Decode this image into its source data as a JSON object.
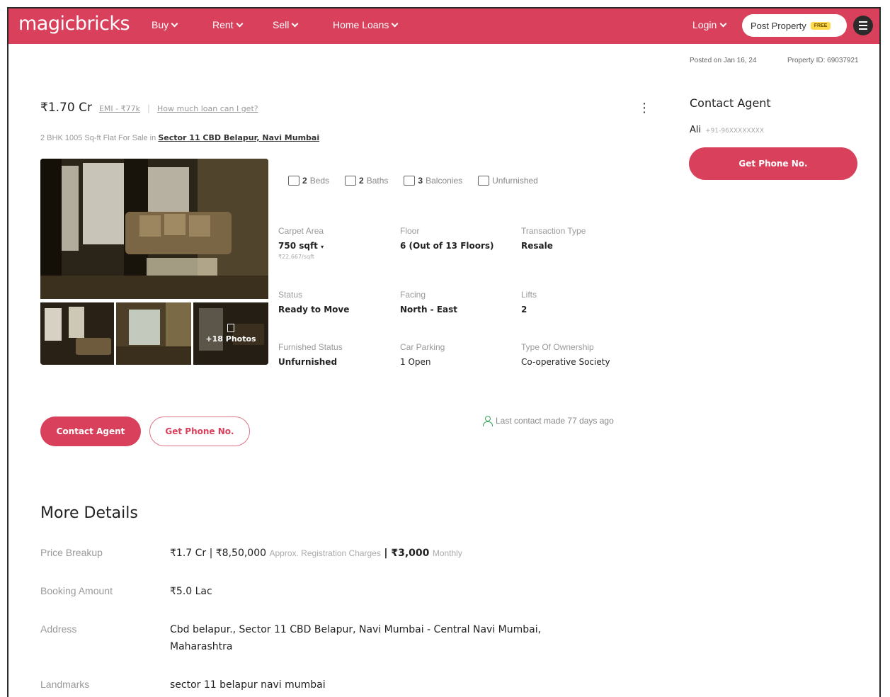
{
  "header": {
    "logo": "magicbricks",
    "nav": [
      "Buy",
      "Rent",
      "Sell",
      "Home Loans"
    ],
    "login": "Login",
    "post_property": "Post Property",
    "free_badge": "FREE"
  },
  "meta": {
    "posted": "Posted on Jan 16, 24",
    "property_id": "Property ID: 69037921"
  },
  "listing": {
    "price": "₹1.70 Cr",
    "emi": "EMI - ₹77k",
    "loan_link": "How much loan can I get?",
    "subtitle_prefix": "2 BHK 1005 Sq-ft Flat For Sale in",
    "locality": "Sector 11 CBD Belapur, Navi Mumbai",
    "photos_more": "+18 Photos",
    "features": [
      {
        "icon": "bed-icon",
        "count": "2",
        "label": "Beds"
      },
      {
        "icon": "bath-icon",
        "count": "2",
        "label": "Baths"
      },
      {
        "icon": "balcony-icon",
        "count": "3",
        "label": "Balconies"
      },
      {
        "icon": "furnishing-icon",
        "count": "",
        "label": "Unfurnished"
      }
    ],
    "specs": {
      "carpet_area": {
        "label": "Carpet Area",
        "value": "750 sqft",
        "sub": "₹22,667/sqft"
      },
      "floor": {
        "label": "Floor",
        "value": "6 (Out of 13 Floors)"
      },
      "transaction": {
        "label": "Transaction Type",
        "value": "Resale"
      },
      "status": {
        "label": "Status",
        "value": "Ready to Move"
      },
      "facing": {
        "label": "Facing",
        "value": "North - East"
      },
      "lifts": {
        "label": "Lifts",
        "value": "2"
      },
      "furnished": {
        "label": "Furnished Status",
        "value": "Unfurnished"
      },
      "parking": {
        "label": "Car Parking",
        "value": "1 Open"
      },
      "ownership": {
        "label": "Type Of Ownership",
        "value": "Co-operative Society"
      }
    },
    "contact_agent_button": "Contact Agent",
    "get_phone_button": "Get Phone No.",
    "last_contact": "Last contact made 77 days ago"
  },
  "side": {
    "title": "Contact Agent",
    "agent_name": "Ali",
    "agent_phone": "+91-96XXXXXXXX",
    "button": "Get Phone No."
  },
  "more_details": {
    "title": "More Details",
    "price_breakup": {
      "label": "Price Breakup",
      "v1": "₹1.7 Cr | ₹8,50,000",
      "v1_note": "Approx. Registration Charges",
      "v2": "| ₹3,000",
      "v2_note": "Monthly"
    },
    "booking": {
      "label": "Booking Amount",
      "value": "₹5.0 Lac"
    },
    "address": {
      "label": "Address",
      "line1": "Cbd belapur., Sector 11 CBD Belapur, Navi Mumbai - Central Navi Mumbai,",
      "line2": "Maharashtra"
    },
    "landmarks": {
      "label": "Landmarks",
      "value": "sector 11 belapur navi mumbai"
    }
  }
}
